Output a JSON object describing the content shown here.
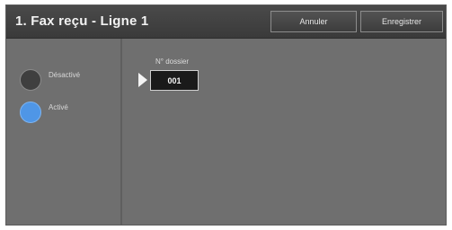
{
  "header": {
    "title": "1. Fax reçu - Ligne 1",
    "cancel_label": "Annuler",
    "save_label": "Enregistrer"
  },
  "options": [
    {
      "label": "Désactivé",
      "selected": false,
      "indicator_icon": "radio-off-icon"
    },
    {
      "label": "Activé",
      "selected": true,
      "indicator_icon": "radio-on-icon"
    }
  ],
  "main": {
    "field_label": "N° dossier",
    "field_value": "001",
    "pointer_icon": "triangle-right-icon"
  },
  "colors": {
    "frame_bg": "#6f6f6f",
    "header_bg": "#3a3a3a",
    "selected_radio": "#4f96e6",
    "unselected_radio": "#3f3f3f",
    "value_box_bg": "#1a1a1a"
  }
}
